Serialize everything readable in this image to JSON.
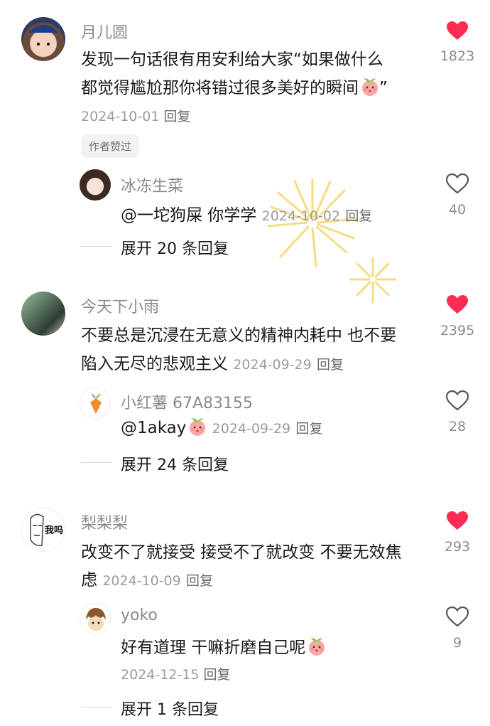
{
  "comments": [
    {
      "user": "月儿圆",
      "text_lines": [
        "发现一句话很有用安利给大家“如果做什么",
        "都觉得尴尬那你将错过很多美好的瞬间",
        "”"
      ],
      "date": "2024-10-01",
      "reply_label": "回复",
      "like_count": "1823",
      "liked": true,
      "badge": "作者赞过",
      "reply": {
        "user": "冰冻生菜",
        "text": "@一坨狗屎 你学学",
        "date": "2024-10-02",
        "reply_label": "回复",
        "like_count": "40",
        "liked": false
      },
      "expand": "展开 20 条回复"
    },
    {
      "user": "今天下小雨",
      "text_lines": [
        "不要总是沉浸在无意义的精神内耗中 也不要",
        "陷入无尽的悲观主义"
      ],
      "date": "2024-09-29",
      "reply_label": "回复",
      "like_count": "2395",
      "liked": true,
      "reply": {
        "user": "小红薯 67A83155",
        "text": "@1akay",
        "date": "2024-09-29",
        "reply_label": "回复",
        "like_count": "28",
        "liked": false
      },
      "expand": "展开 24 条回复"
    },
    {
      "user": "梨梨梨",
      "avatar_text": "我吗",
      "text_lines": [
        "改变不了就接受 接受不了就改变 不要无效焦",
        "虑"
      ],
      "date": "2024-10-09",
      "reply_label": "回复",
      "like_count": "293",
      "liked": true,
      "reply": {
        "user": "yoko",
        "text": "好有道理 干嘛折磨自己呢",
        "date": "2024-12-15",
        "reply_label": "回复",
        "like_count": "9",
        "liked": false
      },
      "expand": "展开 1 条回复"
    }
  ],
  "colors": {
    "heart_liked": "#fe2c55",
    "heart_outline": "#555555",
    "firework": "#f5d66a"
  },
  "icons": {
    "liked": "heart-filled-icon",
    "unliked": "heart-outline-icon",
    "emoji": "peach-face-emoji"
  }
}
